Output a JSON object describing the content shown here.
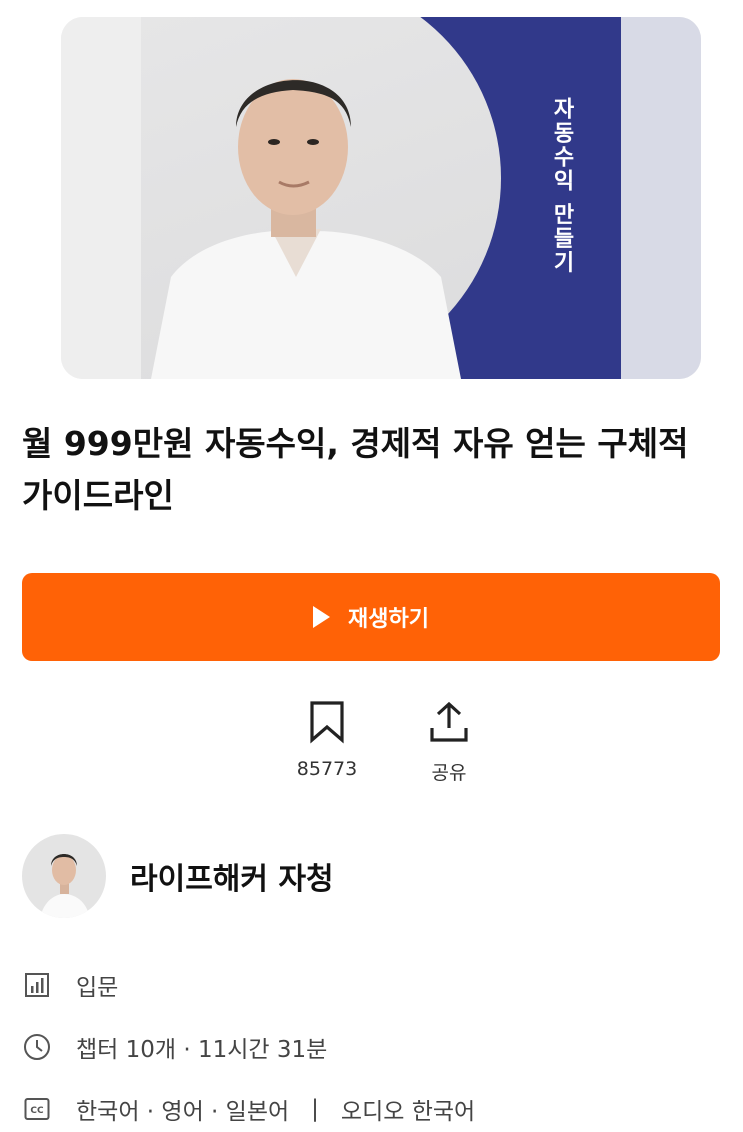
{
  "hero": {
    "vertical_text": "자동수익 만들기",
    "panel_color": "#31398a"
  },
  "course": {
    "title": "월 999만원 자동수익, 경제적 자유 얻는 구체적 가이드라인"
  },
  "play_button": {
    "label": "재생하기",
    "color": "#ff6206",
    "icon": "play-icon"
  },
  "actions": {
    "bookmark_count": "85773",
    "share_label": "공유"
  },
  "author": {
    "name": "라이프해커 자청"
  },
  "meta": {
    "level": "입문",
    "duration": "챕터 10개 · 11시간 31분",
    "subtitles": "한국어 · 영어 · 일본어",
    "divider": "|",
    "audio": "오디오 한국어"
  }
}
